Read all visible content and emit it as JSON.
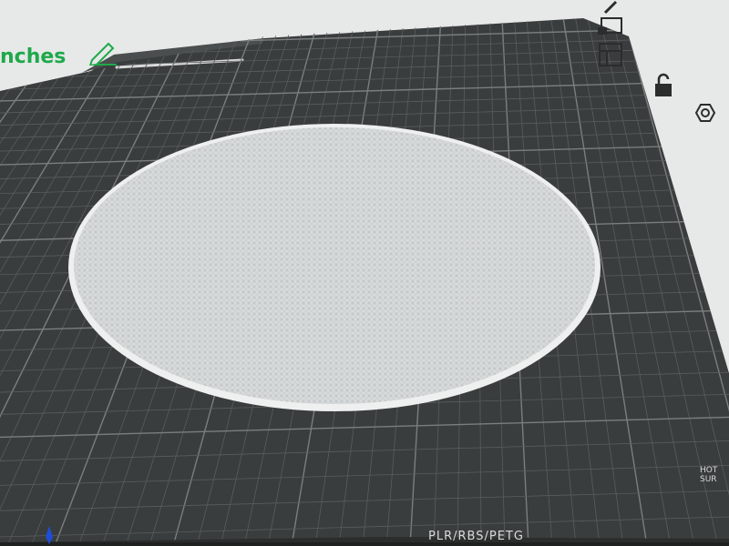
{
  "app": {
    "plate_name_partial": "nches",
    "plate_type_label": "PLR/RBS/PETG",
    "hot_label_line1": "HOT",
    "hot_label_line2": "SUR"
  },
  "colors": {
    "background": "#e7e8e8",
    "plate": "#3a3d3d",
    "grid_minor": "#595d5d",
    "grid_major": "#7a7e7e",
    "accent_green": "#1ea94a",
    "model": "#d9dcdc",
    "axis_blue": "#1e4dd8"
  },
  "side_toolbar": [
    {
      "name": "edit-pencil-icon"
    },
    {
      "name": "plate-view-icon"
    },
    {
      "name": "arrange-icon"
    },
    {
      "name": "lock-icon"
    },
    {
      "name": "settings-hex-icon"
    }
  ]
}
